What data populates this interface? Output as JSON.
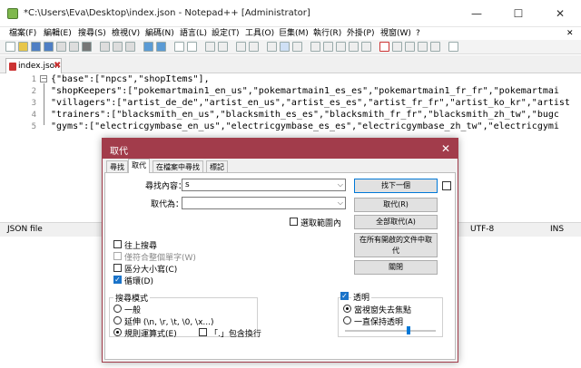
{
  "window": {
    "title": "*C:\\Users\\Eva\\Desktop\\index.json - Notepad++ [Administrator]",
    "min": "—",
    "max": "☐",
    "close": "✕"
  },
  "menu": [
    "檔案(F)",
    "編輯(E)",
    "搜尋(S)",
    "檢視(V)",
    "編碼(N)",
    "語言(L)",
    "設定(T)",
    "工具(O)",
    "巨集(M)",
    "執行(R)",
    "外掛(P)",
    "視窗(W)",
    "?"
  ],
  "menu_close": "✕",
  "tab": {
    "label": "index.json",
    "close": "✖"
  },
  "editor": {
    "line_numbers": [
      "1",
      "2",
      "3",
      "4",
      "5"
    ],
    "lines": [
      "{\"base\":[\"npcs\",\"shopItems\"],",
      "\"shopKeepers\":[\"pokemartmain1_en_us\",\"pokemartmain1_es_es\",\"pokemartmain1_fr_fr\",\"pokemartmai",
      "\"villagers\":[\"artist_de_de\",\"artist_en_us\",\"artist_es_es\",\"artist_fr_fr\",\"artist_ko_kr\",\"artist",
      "\"trainers\":[\"blacksmith_en_us\",\"blacksmith_es_es\",\"blacksmith_fr_fr\",\"blacksmith_zh_tw\",\"bugc",
      "\"gyms\":[\"electricgymbase_en_us\",\"electricgymbase_es_es\",\"electricgymbase_zh_tw\",\"electricgymi"
    ]
  },
  "status": {
    "file_type": "JSON file",
    "encoding": "UTF-8",
    "mode": "INS"
  },
  "dialog": {
    "title": "取代",
    "close": "✕",
    "tabs": [
      "尋找",
      "取代",
      "在檔案中尋找",
      "標記"
    ],
    "find_label": "尋找內容：",
    "find_value": "s",
    "replace_label": "取代為：",
    "replace_value": "",
    "in_selection": "選取範圍內",
    "buttons": {
      "find_next": "找下一個",
      "replace": "取代(R)",
      "replace_all": "全部取代(A)",
      "replace_all_open": "在所有開啟的文件中取代",
      "close": "關閉"
    },
    "options": {
      "backward": "往上搜尋",
      "whole_word": "僅符合整個單字(W)",
      "match_case": "區分大小寫(C)",
      "wrap": "循環(D)"
    },
    "search_mode": {
      "title": "搜尋模式",
      "normal": "一般",
      "extended": "延伸 (\\n, \\r, \\t, \\0, \\x...)",
      "regex": "規則運算式(E)",
      "dot_newline": "「.」包含換行"
    },
    "transparency": {
      "title": "透明",
      "on_lose_focus": "當視窗失去焦點",
      "always": "一直保持透明",
      "level": 0.7
    }
  }
}
